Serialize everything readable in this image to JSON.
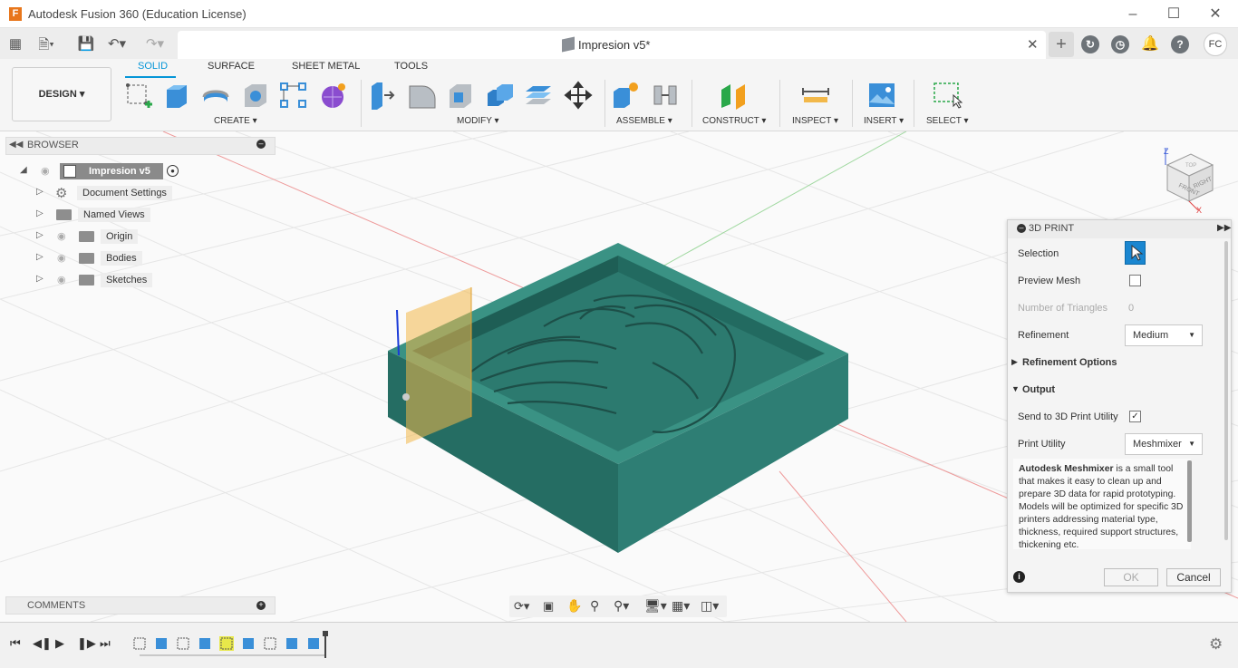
{
  "window": {
    "title": "Autodesk Fusion 360 (Education License)",
    "logo": "F"
  },
  "doc_tab": {
    "label": "Impresion v5*"
  },
  "user": {
    "initials": "FC"
  },
  "workspace": {
    "label": "DESIGN ▾"
  },
  "ribbon": {
    "tabs": [
      "SOLID",
      "SURFACE",
      "SHEET METAL",
      "TOOLS"
    ],
    "groups": [
      "CREATE ▾",
      "MODIFY ▾",
      "ASSEMBLE ▾",
      "CONSTRUCT ▾",
      "INSPECT ▾",
      "INSERT ▾",
      "SELECT ▾"
    ]
  },
  "browser": {
    "title": "BROWSER",
    "root": "Impresion v5",
    "items": [
      "Document Settings",
      "Named Views",
      "Origin",
      "Bodies",
      "Sketches"
    ]
  },
  "comments": {
    "title": "COMMENTS"
  },
  "panel": {
    "title": "3D PRINT",
    "selection_label": "Selection",
    "preview_label": "Preview Mesh",
    "triangles_label": "Number of Triangles",
    "triangles_value": "0",
    "refinement_label": "Refinement",
    "refinement_value": "Medium",
    "refinement_options": "Refinement Options",
    "output": "Output",
    "send_label": "Send to 3D Print Utility",
    "send_checked": true,
    "utility_label": "Print Utility",
    "utility_value": "Meshmixer",
    "desc_bold": "Autodesk Meshmixer",
    "desc_text": " is a small tool that makes it easy to clean up and prepare 3D data for rapid prototyping. Models will be optimized for specific 3D printers addressing material type, thickness, required support structures, thickening etc.",
    "ok": "OK",
    "cancel": "Cancel"
  },
  "viewcube": {
    "top": "TOP",
    "front": "FRONT",
    "right": "RIGHT",
    "z": "Z",
    "x": "X"
  },
  "colors": {
    "accent": "#0696d7",
    "body": "#2e7e74",
    "select_btn": "#1a86d0"
  }
}
